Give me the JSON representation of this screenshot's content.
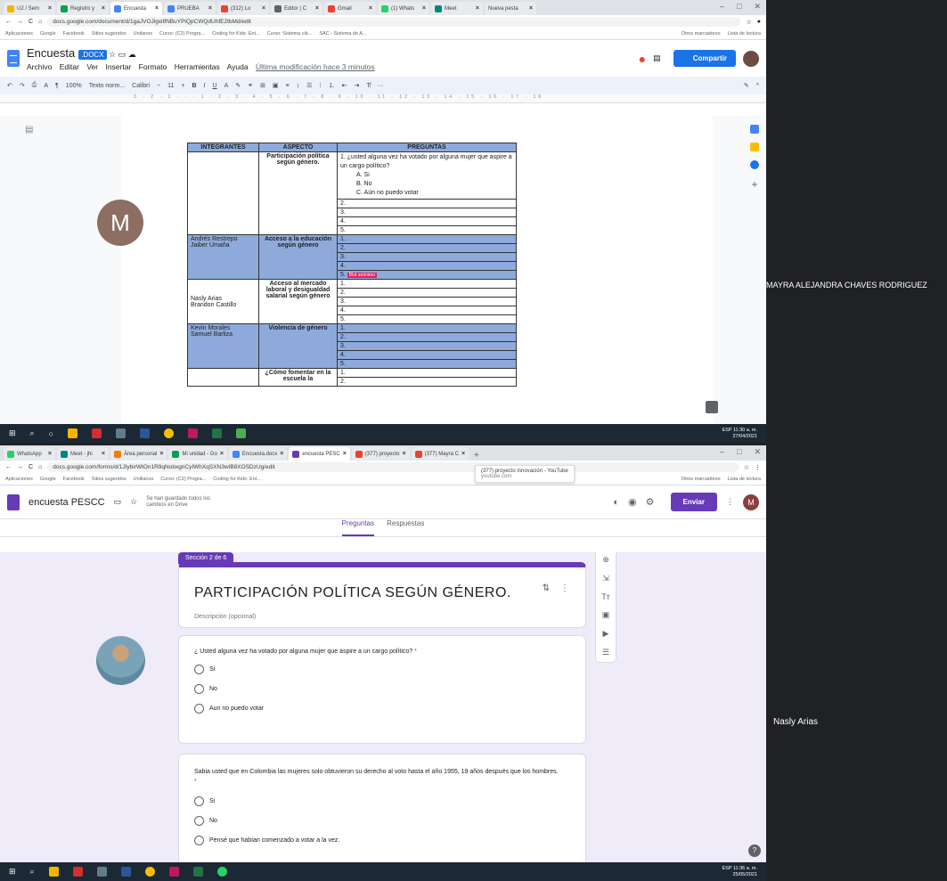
{
  "top": {
    "tabs": [
      "U2 / Sem",
      "Registro y",
      "Encuesta",
      "PRUEBA",
      "(312) Lo",
      "Editor | C",
      "Gmail",
      "(1) Whats",
      "Meet",
      "Nueva pesta"
    ],
    "url": "docs.google.com/document/d/1gaJVOJlgxitfNBuYPiQpCWQdUhfE2tbMd/edit",
    "bookmarks": [
      "Aplicaciones",
      "Google",
      "Facebook",
      "Sitios sugeridos",
      "Unilanos",
      "Curso: (C2) Progra...",
      "Coding for Kids: Ent...",
      "Curso: Sistema cib...",
      "SAC - Sistema de A...",
      "Otros marcadores",
      "Lista de lectura"
    ],
    "doc_title": "Encuesta",
    "doc_badge": ".DOCX",
    "menus": [
      "Archivo",
      "Editar",
      "Ver",
      "Insertar",
      "Formato",
      "Herramientas",
      "Ayuda"
    ],
    "last_edit": "Última modificación hace 3 minutos",
    "share": "Compartir",
    "zoom": "100%",
    "style": "Texto norm...",
    "font": "Calibri",
    "size": "11",
    "table": {
      "headers": [
        "INTEGRANTES",
        "ASPECTO",
        "PREGUNTAS"
      ],
      "q1": "1.  ¿usted alguna vez ha votado por alguna mujer que aspire a un cargo político?",
      "q1_opts": [
        "A.  Si",
        "B.  No",
        "C.  Aún no puedo votar"
      ],
      "aspects": [
        "Participación política según género.",
        "Acceso a la educación según género",
        "Acceso al mercado laboral y desigualdad salarial según género",
        "Violencia de género",
        "¿Cómo fomentar en la escuela la"
      ],
      "members": [
        "",
        "Andrés Restrepo\nJaiber Umaña",
        "Nasly Arias\nBrandon Castillo",
        "Kevin Morales\nSamuel Barliza",
        ""
      ],
      "anon": "Blot anónimo"
    },
    "clock": "11:30 a. m.",
    "date": "27/04/2021",
    "lang": "ESP"
  },
  "bottom": {
    "tabs": [
      "WhatsApp",
      "Meet - jhi",
      "Área personal",
      "Mi unidad - Go",
      "Encuesta.docx",
      "encuesta PESC",
      "(377) proyecto",
      "(377) Mayra C"
    ],
    "url": "docs.google.com/forms/d/1JIybirWtOn1R9qNobxgnCyIWhXqSXN3wIB8XOSDzUg/edit",
    "tooltip_title": "(377) proyecto innovación - YouTube",
    "tooltip_url": "youtube.com",
    "bookmarks": [
      "Aplicaciones",
      "Google",
      "Facebook",
      "Sitios sugeridos",
      "Unillanos",
      "Curso: (C2) Progra...",
      "Coding for Kids: Ent...",
      "Otros marcadores",
      "Lista de lectura"
    ],
    "form_title": "encuesta PESCC",
    "saved": "Se han guardado todos los cambios en Drive",
    "send": "Enviar",
    "avatar": "M",
    "tab_q": "Preguntas",
    "tab_r": "Respuestas",
    "section": "Sección 2 de 6",
    "section_title": "PARTICIPACIÓN POLÍTICA SEGÚN GÉNERO.",
    "section_desc": "Descripción (opcional)",
    "q1": "¿ Usted alguna vez ha votado por alguna mujer que aspire a un cargo político?",
    "q1_opts": [
      "Si",
      "No",
      "Aun no puedo votar"
    ],
    "q2": "Sabia usted que en Colombia las mujeres solo obtuvieron su derecho al voto hasta el año 1955, 19 años después que los hombres.",
    "q2_opts": [
      "Si",
      "No",
      "Pensé que habían comenzado a votar a la vez."
    ],
    "clock": "11:36 a. m.",
    "date": "25/05/2021",
    "lang": "ESP"
  },
  "participants": {
    "p1_initial": "M",
    "p1_name": "MAYRA ALEJANDRA CHAVES RODRIGUEZ",
    "p2_name": "Nasly Arias"
  }
}
